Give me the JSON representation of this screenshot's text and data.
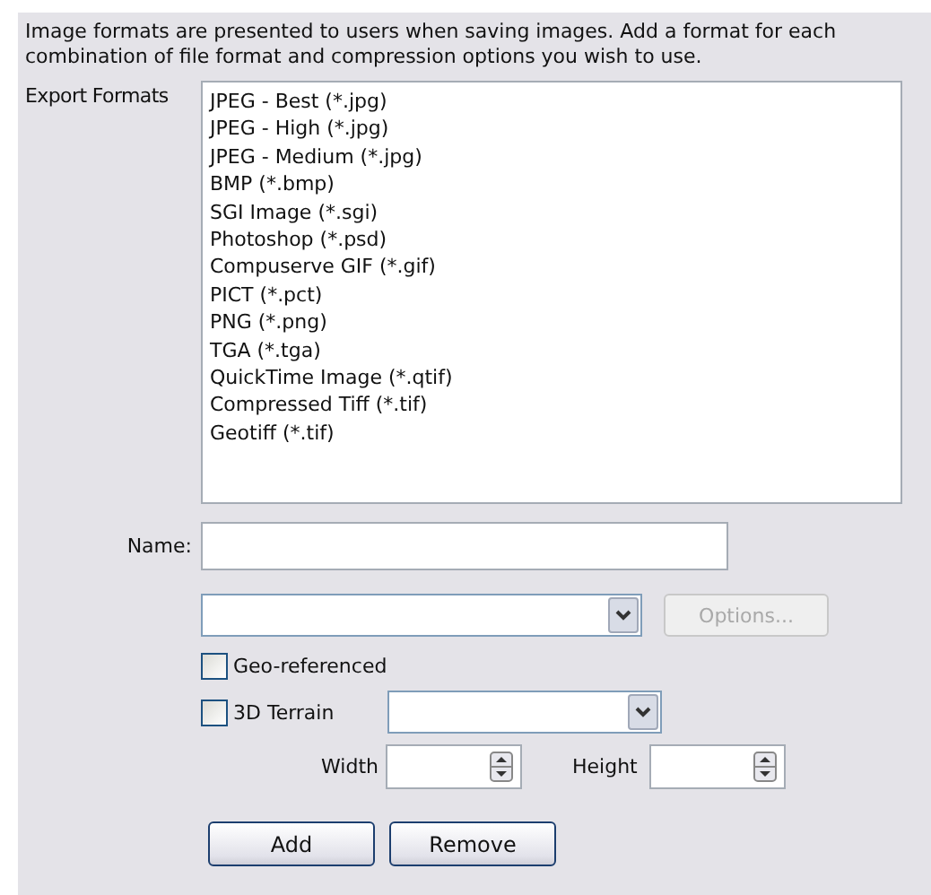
{
  "description": "Image formats are presented to users when saving images. Add a format for each combination of file format and compression options you wish to use.",
  "export_formats": {
    "label": "Export Formats",
    "items": [
      {
        "label": "JPEG - Best (*.jpg)",
        "selected": false
      },
      {
        "label": "JPEG - High (*.jpg)",
        "selected": false
      },
      {
        "label": "JPEG - Medium (*.jpg)",
        "selected": false
      },
      {
        "label": "BMP (*.bmp)",
        "selected": false
      },
      {
        "label": "SGI Image (*.sgi)",
        "selected": false
      },
      {
        "label": "Photoshop (*.psd)",
        "selected": false
      },
      {
        "label": "Compuserve GIF (*.gif)",
        "selected": false
      },
      {
        "label": "PICT (*.pct)",
        "selected": false
      },
      {
        "label": "PNG (*.png)",
        "selected": false
      },
      {
        "label": "TGA (*.tga)",
        "selected": false
      },
      {
        "label": "QuickTime Image (*.qtif)",
        "selected": false
      },
      {
        "label": "Compressed Tiff (*.tif)",
        "selected": false
      },
      {
        "label": "Geotiff (*.tif)",
        "selected": false
      }
    ]
  },
  "name": {
    "label": "Name:"
  },
  "options_button": {
    "label": "Options...",
    "disabled": true
  },
  "geo_referenced": {
    "label": "Geo-referenced",
    "checked": false
  },
  "terrain": {
    "label": "3D Terrain",
    "checked": false
  },
  "width": {
    "label": "Width"
  },
  "height": {
    "label": "Height"
  },
  "buttons": [
    "Add",
    "Remove"
  ]
}
